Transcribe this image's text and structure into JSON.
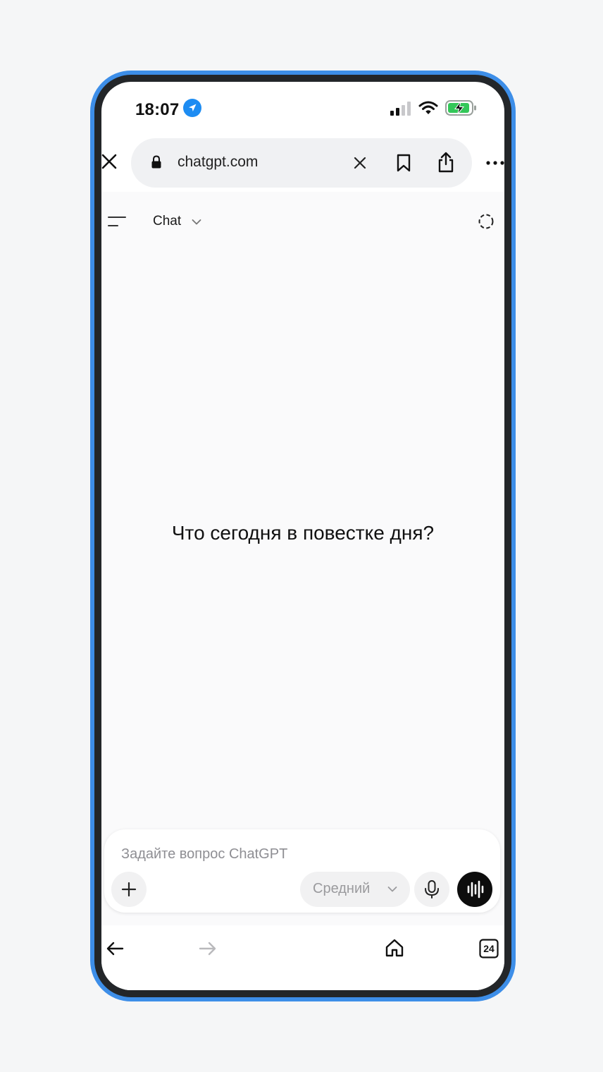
{
  "status_bar": {
    "time": "18:07",
    "icons": [
      "location-arrow-icon",
      "cellular-signal-icon",
      "wifi-icon",
      "battery-charging-icon"
    ],
    "battery_color": "#34c759"
  },
  "browser": {
    "url": "chatgpt.com",
    "icons": [
      "close-icon",
      "lock-icon",
      "clear-icon",
      "bookmark-icon",
      "share-icon",
      "more-icon"
    ]
  },
  "chat_header": {
    "model_label": "Chat",
    "icons": [
      "menu-icon",
      "chevron-down-icon",
      "temporary-chat-icon"
    ]
  },
  "main": {
    "greeting": "Что сегодня в повестке дня?"
  },
  "composer": {
    "placeholder": "Задайте вопрос ChatGPT",
    "model_selector": "Средний",
    "icons": [
      "plus-icon",
      "chevron-down-icon",
      "mic-icon",
      "voice-mode-icon"
    ]
  },
  "bottom_toolbar": {
    "tabs_count": "24",
    "icons": [
      "back-arrow-icon",
      "forward-arrow-icon",
      "home-icon",
      "tabs-icon"
    ]
  },
  "colors": {
    "frame": "#3d8ee8",
    "accent": "#1d8cf2",
    "voice_button": "#0d0d0d"
  }
}
